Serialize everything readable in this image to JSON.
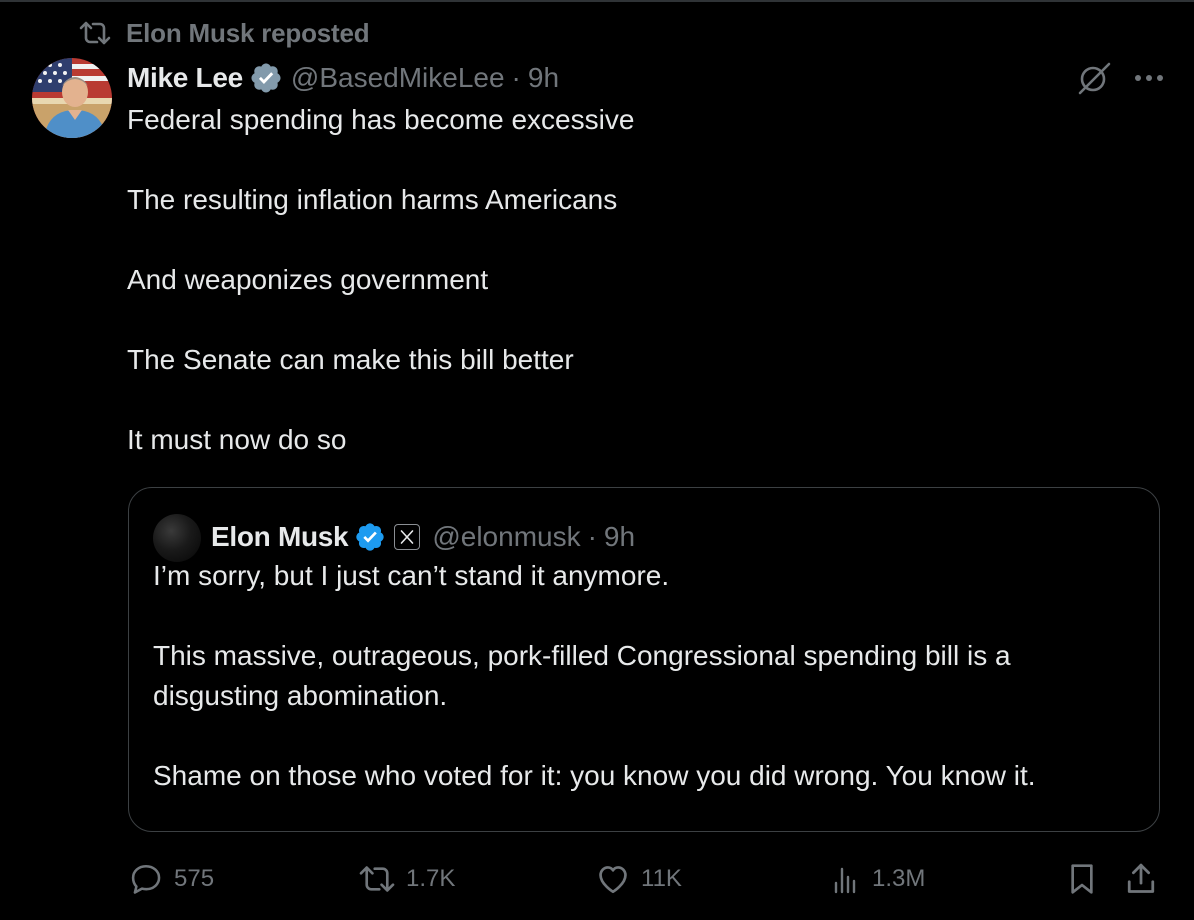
{
  "repost": {
    "icon": "repost-icon",
    "text": "Elon Musk reposted"
  },
  "post": {
    "author": {
      "name": "Mike Lee",
      "handle": "@BasedMikeLee",
      "separator": "·",
      "time": "9h",
      "verified_color": "#829aab"
    },
    "body": [
      "Federal spending has become excessive",
      "The resulting inflation harms Americans",
      "And weaponizes government",
      "The Senate can make this bill better",
      "It must now do so"
    ]
  },
  "top_actions": {
    "grok_icon": "grok-icon",
    "more_icon": "more-icon"
  },
  "quote": {
    "author": {
      "name": "Elon Musk",
      "handle": "@elonmusk",
      "separator": "·",
      "time": "9h",
      "verified_color": "#1d9bf0",
      "affiliate_badge": "x-logo-icon"
    },
    "body": [
      "I’m sorry, but I just can’t stand it anymore.",
      "This massive, outrageous, pork-filled Congressional spending bill is a disgusting abomination.",
      "Shame on those who voted for it: you know you did wrong. You know it."
    ]
  },
  "actions": {
    "replies": "575",
    "reposts": "1.7K",
    "likes": "11K",
    "views": "1.3M"
  },
  "colors": {
    "background": "#000000",
    "text_primary": "#e7e9ea",
    "text_secondary": "#71767b",
    "border": "#3c4043"
  }
}
